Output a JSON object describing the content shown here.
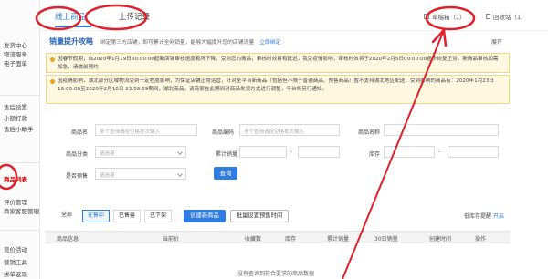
{
  "sidebar": {
    "items": [
      {
        "label": "发货中心"
      },
      {
        "label": "物流服务"
      },
      {
        "label": "电子面单"
      },
      {
        "label": "售后设置"
      },
      {
        "label": "小额打款"
      },
      {
        "label": "售后小助手"
      },
      {
        "label": "商品列表"
      },
      {
        "label": "评价管理"
      },
      {
        "label": "商家客服管理"
      },
      {
        "label": "竞价活动"
      },
      {
        "label": "营销工具"
      },
      {
        "label": "拼单返现"
      }
    ]
  },
  "header": {
    "tabs": [
      {
        "label": "线上商品"
      },
      {
        "label": "上传记录"
      }
    ],
    "drafts_label": "草稿箱（1）",
    "recycle_label": "回收站（1）"
  },
  "banner": {
    "title": "销量提升攻略",
    "desc": "绑定第三方店铺，即可累计全网销量，能够大幅提升您的店铺流量",
    "link": "立即绑定",
    "collapse": "展开"
  },
  "notices": [
    {
      "text": "因春节假期，自2020年1月19日00:00:00起新店铺审核速度有所下降，受到您的商品，审核时效将有延迟。我受疫情影响，审核时效将于2020年2月5日00:00:00逐步恢复正常。新商品审核如需加急，请提前预约",
      "highlight": "审核时效"
    },
    {
      "text": "因疫情影响，湖北部分区域物流受到一定程度影响，为保证店铺正常运营，针对全平台新商品（包括但不限于普通商品、预售商品）暂不支持湖北地区配送，受到影响的商品有：2020年1月23日 16:00:00至2020年2月10日 23:59:59期间，湖北商品，请商家在此期间对商品发货方式进行调整，平台将另行通知。"
    }
  ],
  "filters": {
    "product_label": "商品名",
    "product_placeholder": "多个查询请按空格批次输入",
    "code_label": "商品编码",
    "code_placeholder": "多个查询请按空格批次输入",
    "name_label": "商品名称",
    "category_label": "商品分类",
    "category_placeholder": "请选择",
    "sales_label": "累计销量",
    "stock_label": "库存",
    "presale_label": "是否预售",
    "presale_placeholder": "请选择",
    "search_button": "查询"
  },
  "status_tabs": [
    {
      "label": "全部"
    },
    {
      "label": "在售中"
    },
    {
      "label": "已售罄"
    },
    {
      "label": "已下架"
    }
  ],
  "actions": {
    "create": "创建新商品",
    "batch": "批量设置预售时间",
    "low_stock": "低库存提醒",
    "toggle": "开启"
  },
  "table": {
    "headers": [
      "商品信息",
      "当前价",
      "收藏数",
      "库存",
      "累计销量",
      "30日销量",
      "创建时间",
      "操作"
    ],
    "empty": "没有查询到符合要求的商品数据"
  }
}
